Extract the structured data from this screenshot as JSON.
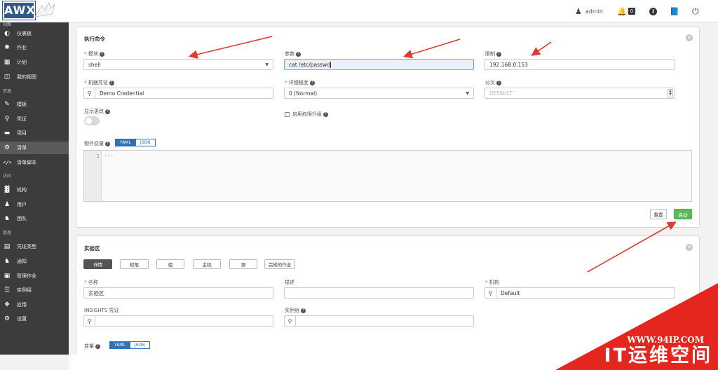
{
  "brand": {
    "logo_text": "AWX"
  },
  "topbar": {
    "user": "admin",
    "notifications_count": "0"
  },
  "sidebar": {
    "sections": [
      {
        "label": "视图"
      },
      {
        "label": "资源"
      },
      {
        "label": "访问"
      },
      {
        "label": "管理"
      }
    ],
    "items": [
      {
        "label": "仪表板",
        "icon": "dashboard-icon"
      },
      {
        "label": "作业",
        "icon": "spinner-icon"
      },
      {
        "label": "计划",
        "icon": "calendar-icon"
      },
      {
        "label": "我的视图",
        "icon": "columns-icon"
      },
      {
        "label": "模板",
        "icon": "edit-icon"
      },
      {
        "label": "凭证",
        "icon": "key-icon"
      },
      {
        "label": "项目",
        "icon": "folder-icon"
      },
      {
        "label": "清单",
        "icon": "sitemap-icon"
      },
      {
        "label": "清单脚本",
        "icon": "code-icon"
      },
      {
        "label": "机构",
        "icon": "building-icon"
      },
      {
        "label": "用户",
        "icon": "user-icon"
      },
      {
        "label": "团队",
        "icon": "users-icon"
      },
      {
        "label": "凭证类型",
        "icon": "list-icon"
      },
      {
        "label": "通知",
        "icon": "bell-icon"
      },
      {
        "label": "管理作业",
        "icon": "briefcase-icon"
      },
      {
        "label": "实例组",
        "icon": "server-icon"
      },
      {
        "label": "应用",
        "icon": "cubes-icon"
      },
      {
        "label": "设置",
        "icon": "cog-icon"
      }
    ]
  },
  "command_panel": {
    "title": "执行命令",
    "module": {
      "label": "模块",
      "value": "shell"
    },
    "args": {
      "label": "参数",
      "value": "cat /etc/passwd"
    },
    "limit": {
      "label": "限制",
      "value": "192.168.0.153"
    },
    "credential": {
      "label": "机器凭证",
      "value": "Demo Credential"
    },
    "verbosity": {
      "label": "详细程度",
      "value": "0 (Normal)"
    },
    "forks": {
      "label": "分叉",
      "placeholder": "DEFAULT"
    },
    "show_changes": {
      "label": "显示更改"
    },
    "privilege": {
      "label": "启用权限升级"
    },
    "extra_vars": {
      "label": "额外变量",
      "yaml": "YAML",
      "json": "JSON",
      "line_no": "1",
      "code": "---"
    },
    "buttons": {
      "reset": "重置",
      "launch": "启动"
    }
  },
  "inventory_panel": {
    "title": "实验区",
    "tabs": [
      "详情",
      "权限",
      "组",
      "主机",
      "源",
      "完成的作业"
    ],
    "name": {
      "label": "名称",
      "value": "实验区"
    },
    "description": {
      "label": "描述",
      "value": ""
    },
    "organization": {
      "label": "机构",
      "value": "Default"
    },
    "insights": {
      "label": "INSIGHTS 凭证"
    },
    "instance_groups": {
      "label": "实例组"
    },
    "variables": {
      "label": "变量",
      "yaml": "YAML",
      "json": "JSON"
    }
  },
  "watermark": {
    "url": "WWW.94IP.COM",
    "name": "IT运维空间"
  },
  "colors": {
    "sidebar_bg": "#3c3c3c",
    "accent_blue": "#2f72b5",
    "launch_green": "#5cb85c",
    "annotation_red": "#e03b2f",
    "watermark_red": "#e4261f"
  }
}
